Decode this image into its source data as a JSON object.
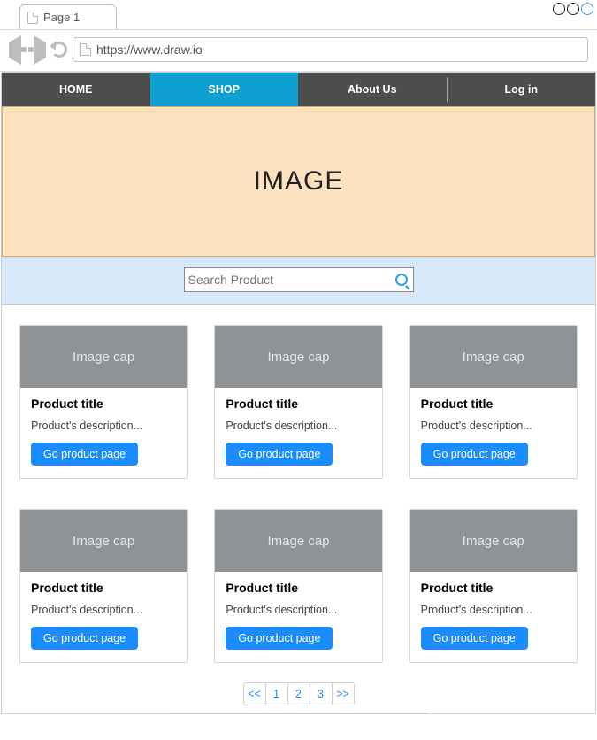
{
  "browser": {
    "tab_label": "Page 1",
    "url": "https://www.draw.io"
  },
  "nav": {
    "items": [
      {
        "label": "HOME",
        "active": false
      },
      {
        "label": "SHOP",
        "active": true
      },
      {
        "label": "About Us",
        "active": false
      },
      {
        "label": "Log in",
        "active": false
      }
    ]
  },
  "hero": {
    "image_label": "IMAGE"
  },
  "search": {
    "placeholder": "Search Product"
  },
  "products": {
    "image_cap_label": "Image cap",
    "title": "Product title",
    "description": "Product's description...",
    "button_label": "Go product page"
  },
  "pagination": {
    "prev": "<<",
    "pages": [
      "1",
      "2",
      "3"
    ],
    "next": ">>"
  }
}
